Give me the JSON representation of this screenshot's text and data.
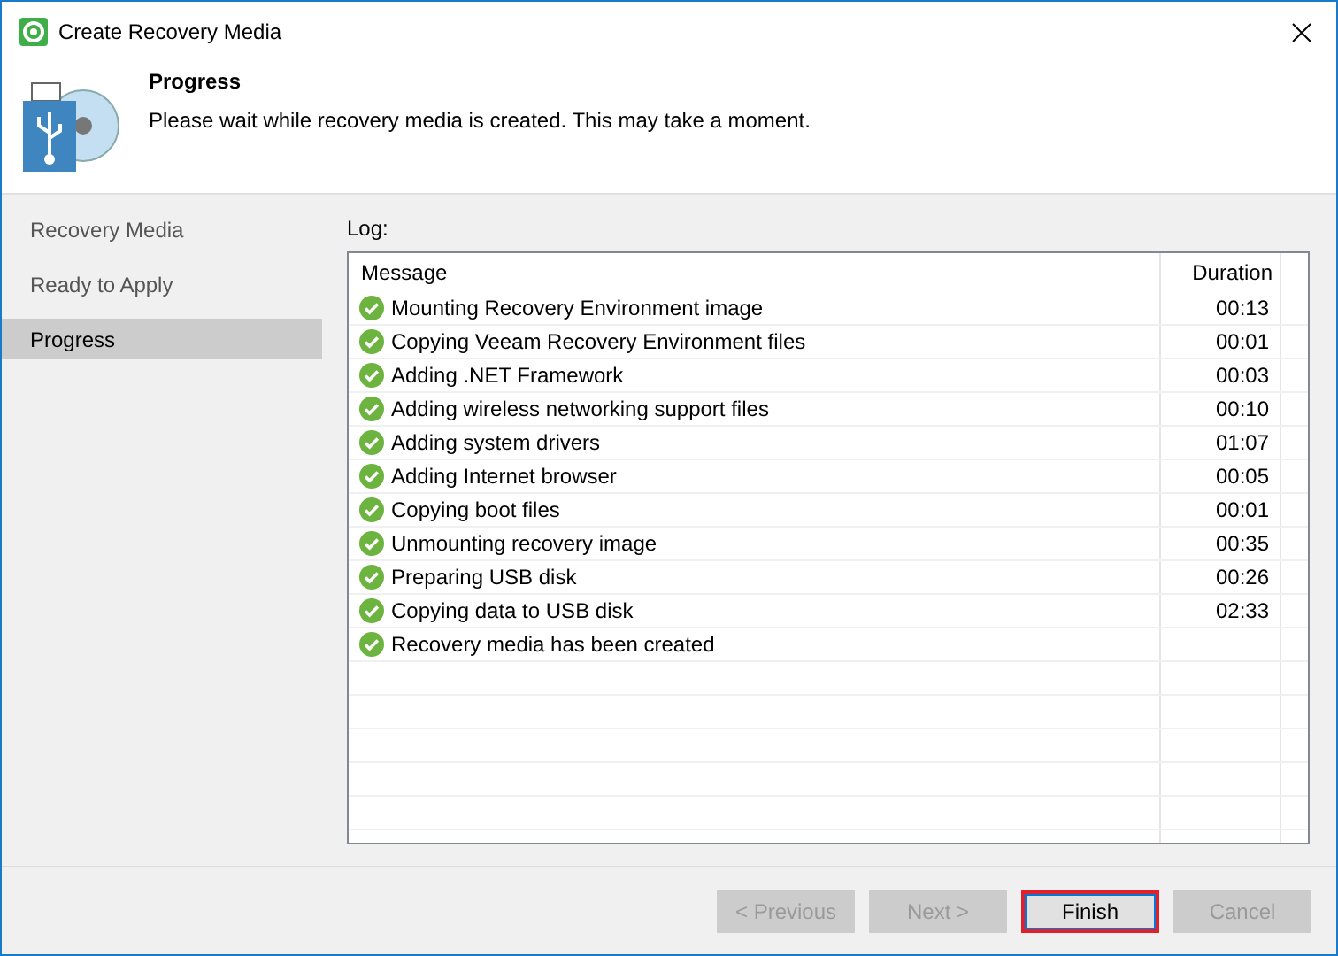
{
  "window": {
    "title": "Create Recovery Media"
  },
  "header": {
    "title": "Progress",
    "subtitle": "Please wait while recovery media is created. This may take a moment."
  },
  "sidebar": {
    "items": [
      {
        "label": "Recovery Media",
        "selected": false
      },
      {
        "label": "Ready to Apply",
        "selected": false
      },
      {
        "label": "Progress",
        "selected": true
      }
    ]
  },
  "log": {
    "label": "Log:",
    "columns": [
      "Message",
      "Duration"
    ],
    "rows": [
      {
        "message": "Mounting Recovery Environment image",
        "duration": "00:13",
        "kind": "success"
      },
      {
        "message": "Copying Veeam Recovery Environment files",
        "duration": "00:01",
        "kind": "success"
      },
      {
        "message": "Adding .NET Framework",
        "duration": "00:03",
        "kind": "success"
      },
      {
        "message": "Adding wireless networking support files",
        "duration": "00:10",
        "kind": "success"
      },
      {
        "message": "Adding system drivers",
        "duration": "01:07",
        "kind": "success"
      },
      {
        "message": "Adding Internet browser",
        "duration": "00:05",
        "kind": "success"
      },
      {
        "message": "Copying boot files",
        "duration": "00:01",
        "kind": "success"
      },
      {
        "message": "Unmounting recovery image",
        "duration": "00:35",
        "kind": "success"
      },
      {
        "message": "Preparing USB disk",
        "duration": "00:26",
        "kind": "success"
      },
      {
        "message": "Copying data to USB disk",
        "duration": "02:33",
        "kind": "success"
      },
      {
        "message": "Recovery media has been created",
        "kind": "success"
      }
    ]
  },
  "buttons": [
    {
      "label": "< Previous",
      "disabled": true,
      "highlighted": false
    },
    {
      "label": "Next >",
      "disabled": true,
      "highlighted": false
    },
    {
      "label": "Finish",
      "disabled": false,
      "highlighted": true
    },
    {
      "label": "Cancel",
      "disabled": true,
      "highlighted": false
    }
  ]
}
